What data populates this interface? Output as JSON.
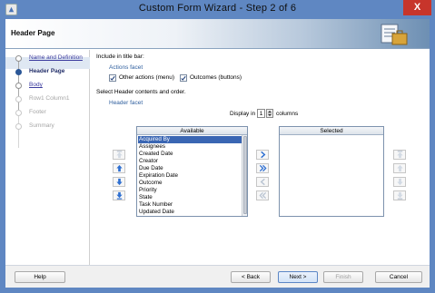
{
  "window": {
    "title": "Custom Form Wizard - Step 2 of 6",
    "close_label": "X"
  },
  "header": {
    "title": "Header Page"
  },
  "nav": {
    "steps": [
      {
        "label": "Name and Definition",
        "state": "link"
      },
      {
        "label": "Header Page",
        "state": "current"
      },
      {
        "label": "Body",
        "state": "link"
      },
      {
        "label": "Row1 Column1",
        "state": "disabled"
      },
      {
        "label": "Footer",
        "state": "disabled"
      },
      {
        "label": "Summary",
        "state": "disabled"
      }
    ]
  },
  "content": {
    "include_title": "Include in title bar:",
    "actions_facet": "Actions facet",
    "other_actions_label": "Other actions (menu)",
    "outcomes_label": "Outcomes (buttons)",
    "other_actions_checked": true,
    "outcomes_checked": true,
    "select_header": "Select Header contents and order.",
    "header_facet": "Header facet",
    "display_in": "Display in",
    "columns_value": "1",
    "columns_label": "columns",
    "available_header": "Available",
    "selected_header": "Selected",
    "available_items": [
      "Acquired By",
      "Assignees",
      "Created Date",
      "Creator",
      "Due Date",
      "Expiration Date",
      "Outcome",
      "Priority",
      "State",
      "Task Number",
      "Updated Date"
    ],
    "selected_index": 0,
    "selected_items": []
  },
  "footer": {
    "help": "Help",
    "back": "< Back",
    "next": "Next >",
    "finish": "Finish",
    "cancel": "Cancel"
  },
  "colors": {
    "titlebar": "#5f87c2",
    "close": "#c7352b",
    "selection": "#3a66b3",
    "arrow_blue": "#2e6fd1"
  },
  "icons": [
    "app-icon",
    "close-icon",
    "move-right-icon",
    "move-all-right-icon",
    "move-left-icon",
    "move-all-left-icon",
    "move-top-icon",
    "move-up-icon",
    "move-down-icon",
    "move-bottom-icon",
    "check-icon"
  ]
}
